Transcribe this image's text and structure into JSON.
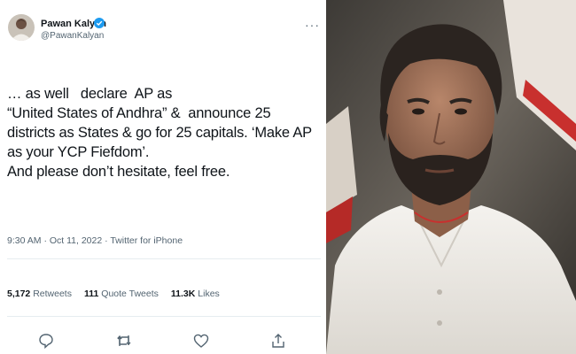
{
  "tweet": {
    "author_name": "Pawan Kalyan",
    "handle": "@PawanKalyan",
    "more_icon": "more-options-icon",
    "text": "… as well   declare  AP as\n“United States of Andhra” &  announce 25 districts as States & go for 25 capitals. ‘Make AP as your YCP Fiefdom’.\nAnd please don’t hesitate, feel free.",
    "timestamp": "9:30 AM · Oct 11, 2022 · Twitter for iPhone",
    "stats": {
      "retweets_count": "5,172",
      "retweets_label": "Retweets",
      "quotes_count": "111",
      "quotes_label": "Quote Tweets",
      "likes_count": "11.3K",
      "likes_label": "Likes"
    },
    "actions": [
      "reply-icon",
      "retweet-icon",
      "like-icon",
      "share-icon"
    ]
  },
  "colors": {
    "verified": "#1d9bf0",
    "text": "#0f1419",
    "secondary": "#536471"
  }
}
